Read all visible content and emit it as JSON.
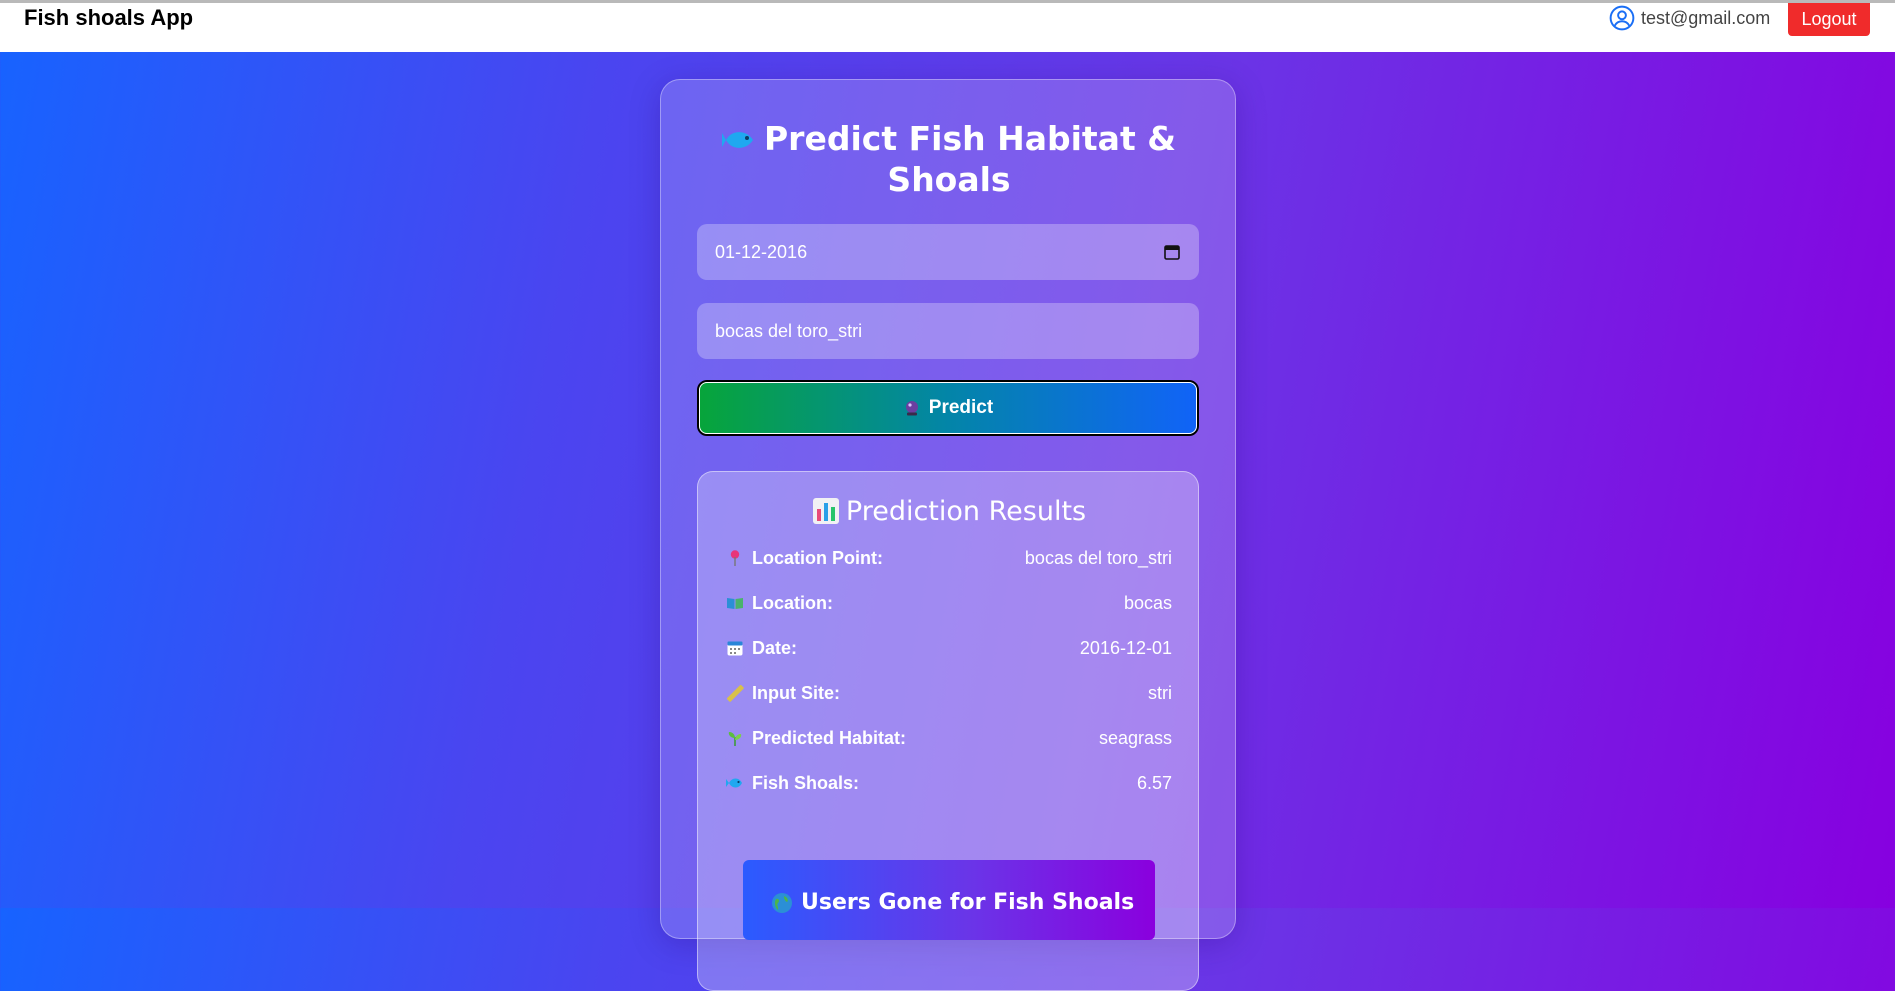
{
  "navbar": {
    "brand": "Fish shoals App",
    "user_email": "test@gmail.com",
    "logout_label": "Logout"
  },
  "form": {
    "title": "Predict Fish Habitat & Shoals",
    "date_value": "01-12-2016",
    "location_value": "bocas del toro_stri",
    "predict_label": "Predict"
  },
  "results": {
    "title": "Prediction Results",
    "rows": [
      {
        "icon": "pin-icon",
        "label": "Location Point:",
        "value": "bocas del toro_stri"
      },
      {
        "icon": "book-icon",
        "label": "Location:",
        "value": "bocas"
      },
      {
        "icon": "calendar-icon",
        "label": "Date:",
        "value": "2016-12-01"
      },
      {
        "icon": "ruler-icon",
        "label": "Input Site:",
        "value": "stri"
      },
      {
        "icon": "seedling-icon",
        "label": "Predicted Habitat:",
        "value": "seagrass"
      },
      {
        "icon": "fish-icon",
        "label": "Fish Shoals:",
        "value": "6.57"
      }
    ]
  },
  "users_panel": {
    "title": "Users Gone for Fish Shoals"
  },
  "colors": {
    "logout_bg": "#f02b2b",
    "predict_start": "#07a53a",
    "predict_end": "#1163f8"
  }
}
